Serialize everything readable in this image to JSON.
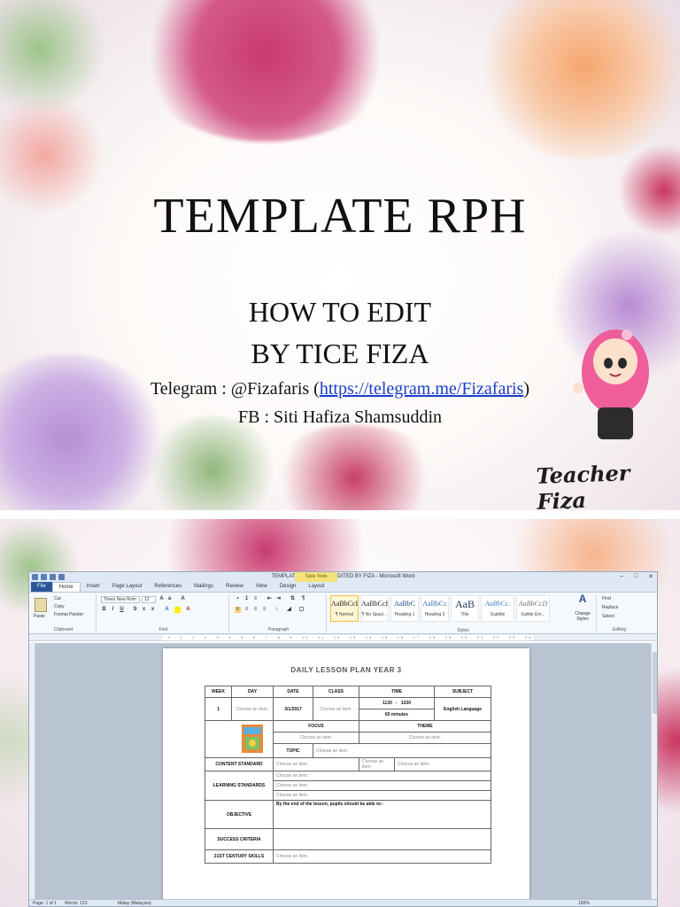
{
  "slide1": {
    "title": "TEMPLATE RPH",
    "line1": "HOW TO EDIT",
    "line2": "BY TICE FIZA",
    "telegram_prefix": "Telegram : @Fizafaris (",
    "telegram_link": "https://telegram.me/Fizafaris",
    "telegram_suffix": ")",
    "fb": "FB : Siti Hafiza Shamsuddin",
    "signature": "Teacher Fiza"
  },
  "word": {
    "window_title": "TEMPLATE YEAR 3 2017 EDITED BY FIZA - Microsoft Word",
    "context_tab": "Table Tools",
    "tabs": [
      "File",
      "Home",
      "Insert",
      "Page Layout",
      "References",
      "Mailings",
      "Review",
      "View",
      "Design",
      "Layout"
    ],
    "ribbon": {
      "paste": "Paste",
      "cut": "Cut",
      "copy": "Copy",
      "format_painter": "Format Painter",
      "clipboard": "Clipboard",
      "font_name": "Times New Rom",
      "font_size": "12",
      "font": "Font",
      "paragraph": "Paragraph",
      "styles_label": "Styles",
      "change_styles": "Change Styles",
      "find": "Find",
      "replace": "Replace",
      "select": "Select",
      "editing": "Editing",
      "styles": [
        {
          "sample": "AaBbCcI",
          "name": "¶ Normal"
        },
        {
          "sample": "AaBbCcI",
          "name": "¶ No Spaci..."
        },
        {
          "sample": "AaBbC",
          "name": "Heading 1"
        },
        {
          "sample": "AaBbCc",
          "name": "Heading 2"
        },
        {
          "sample": "AaB",
          "name": "Title"
        },
        {
          "sample": "AaBbCc.",
          "name": "Subtitle"
        },
        {
          "sample": "AaBbCcD",
          "name": "Subtle Em..."
        }
      ]
    },
    "doc": {
      "title": "DAILY LESSON PLAN YEAR 3",
      "h_week": "WEEK",
      "h_day": "DAY",
      "h_date": "DATE",
      "h_class": "CLASS",
      "h_time": "TIME",
      "h_subject": "SUBJECT",
      "week": "1",
      "choose": "Choose an item.",
      "date": "3/1/2017",
      "time_from": "1130",
      "time_dash": "-",
      "time_to": "1230",
      "minutes": "60 minutes",
      "subject": "English Language",
      "focus": "FOCUS",
      "theme": "THEME",
      "topic": "TOPIC",
      "content_standard": "CONTENT STANDARD",
      "learning_standards": "LEARNING STANDARDS",
      "objective": "OBJECTIVE",
      "objective_text": "By the end of the lesson, pupils should be able to:-",
      "success_criteria": "SUCCESS CRITERIA",
      "century_skills": "21ST CENTURY SKILLS"
    },
    "status": {
      "page": "Page: 1 of 1",
      "words": "Words: 123",
      "language": "Malay (Malaysia)",
      "zoom": "100%"
    }
  }
}
